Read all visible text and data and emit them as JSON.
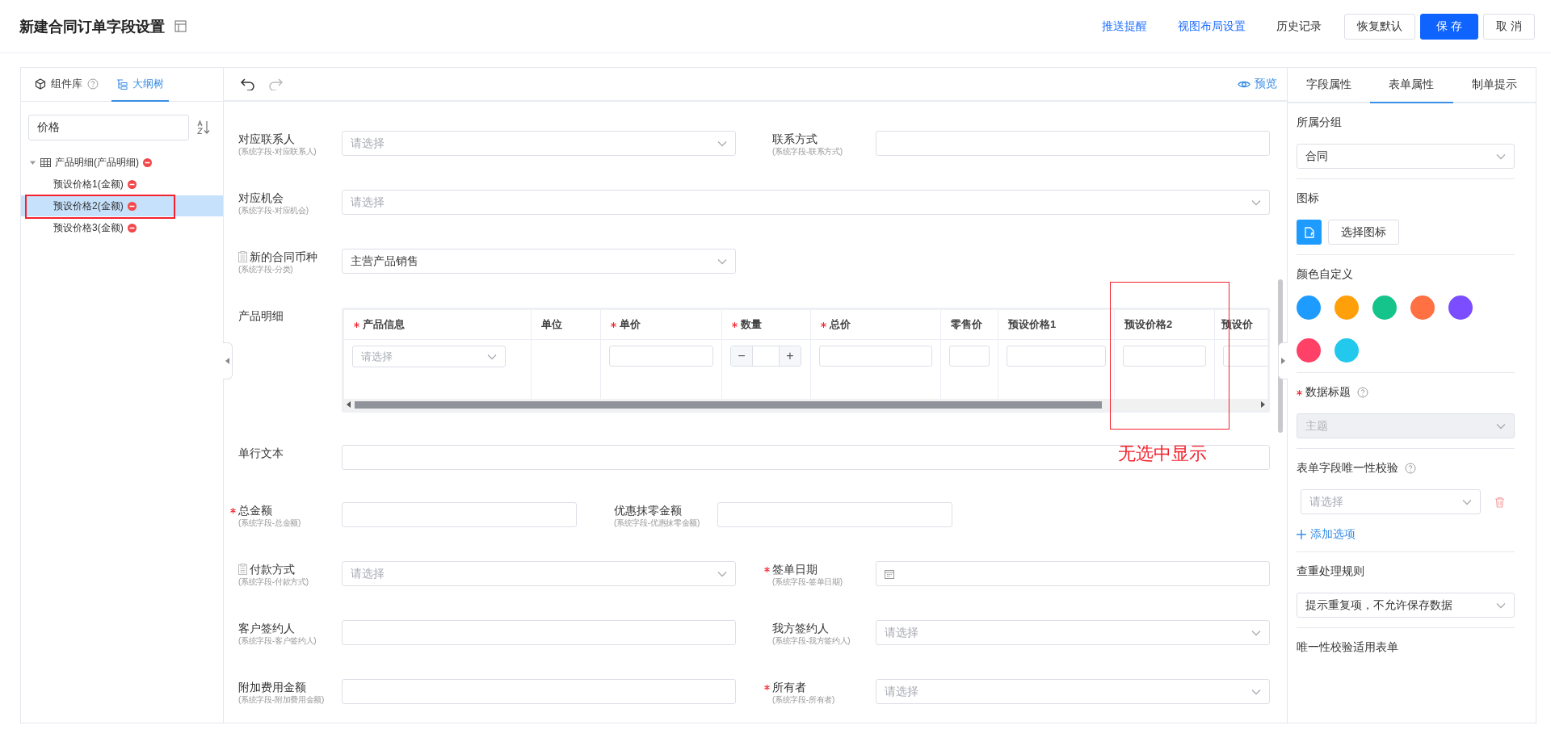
{
  "header": {
    "title": "新建合同订单字段设置",
    "links": [
      {
        "label": "推送提醒",
        "kind": "link"
      },
      {
        "label": "视图布局设置",
        "kind": "link"
      },
      {
        "label": "历史记录",
        "kind": "plain"
      }
    ],
    "buttons": [
      {
        "label": "恢复默认",
        "kind": "default"
      },
      {
        "label": "保 存",
        "kind": "primary"
      },
      {
        "label": "取 消",
        "kind": "default"
      }
    ]
  },
  "left_panel": {
    "tabs": [
      {
        "label": "组件库",
        "selected": false,
        "help": true
      },
      {
        "label": "大纲树",
        "selected": true,
        "help": false
      }
    ],
    "search": {
      "value": "价格"
    },
    "tree": [
      {
        "label": "产品明细(产品明细)",
        "expanded": true,
        "selected": false,
        "children": [
          {
            "label": "预设价格1(金额)",
            "selected": false
          },
          {
            "label": "预设价格2(金额)",
            "selected": true
          },
          {
            "label": "预设价格3(金额)",
            "selected": false
          }
        ]
      }
    ]
  },
  "canvas": {
    "preview": "预览",
    "rows": [
      {
        "fields": [
          {
            "label": "对应联系人",
            "hint": "(系统字段-对应联系人)",
            "required": false,
            "kind": "select",
            "placeholder": "请选择"
          },
          {
            "label": "联系方式",
            "hint": "(系统字段-联系方式)",
            "required": false,
            "kind": "input"
          }
        ]
      },
      {
        "fields": [
          {
            "label": "对应机会",
            "hint": "(系统字段-对应机会)",
            "required": false,
            "kind": "select",
            "placeholder": "请选择"
          }
        ]
      },
      {
        "fields": [
          {
            "label": "新的合同币种",
            "hint": "(系统字段-分类)",
            "required": false,
            "icon": true,
            "kind": "select",
            "value": "主营产品销售"
          }
        ]
      },
      {
        "fields": [
          {
            "label": "产品明细",
            "required": false,
            "kind": "table"
          }
        ]
      },
      {
        "fields": [
          {
            "label": "单行文本",
            "required": false,
            "kind": "input"
          }
        ]
      },
      {
        "fields": [
          {
            "label": "总金额",
            "hint": "(系统字段-总金额)",
            "required": true,
            "kind": "input"
          },
          {
            "label": "优惠抹零金额",
            "hint": "(系统字段-优惠抹零金额)",
            "required": false,
            "kind": "input"
          }
        ]
      },
      {
        "fields": [
          {
            "label": "付款方式",
            "hint": "(系统字段-付款方式)",
            "required": false,
            "icon": true,
            "kind": "select",
            "placeholder": "请选择"
          },
          {
            "label": "签单日期",
            "hint": "(系统字段-签单日期)",
            "required": true,
            "kind": "date"
          }
        ]
      },
      {
        "fields": [
          {
            "label": "客户签约人",
            "hint": "(系统字段-客户签约人)",
            "required": false,
            "kind": "input"
          },
          {
            "label": "我方签约人",
            "hint": "(系统字段-我方签约人)",
            "required": false,
            "kind": "select",
            "placeholder": "请选择"
          }
        ]
      },
      {
        "fields": [
          {
            "label": "附加费用金额",
            "hint": "(系统字段-附加费用金额)",
            "required": false,
            "kind": "input"
          },
          {
            "label": "所有者",
            "hint": "(系统字段-所有者)",
            "required": true,
            "kind": "select",
            "placeholder": "请选择"
          }
        ]
      }
    ],
    "table": {
      "columns": [
        {
          "label": "产品信息",
          "required": true,
          "cell": {
            "kind": "select",
            "placeholder": "请选择"
          }
        },
        {
          "label": "单位",
          "required": false,
          "cell": {
            "kind": "empty"
          }
        },
        {
          "label": "单价",
          "required": true,
          "cell": {
            "kind": "input"
          }
        },
        {
          "label": "数量",
          "required": true,
          "cell": {
            "kind": "stepper",
            "minus": "−",
            "plus": "+"
          }
        },
        {
          "label": "总价",
          "required": true,
          "cell": {
            "kind": "input"
          }
        },
        {
          "label": "零售价",
          "required": false,
          "cell": {
            "kind": "input"
          }
        },
        {
          "label": "预设价格1",
          "required": false,
          "cell": {
            "kind": "input"
          }
        },
        {
          "label": "预设价格2",
          "required": false,
          "cell": {
            "kind": "input"
          }
        },
        {
          "label": "预设价",
          "required": false,
          "cell": {
            "kind": "input"
          }
        }
      ]
    }
  },
  "annotation": {
    "text": "无选中显示"
  },
  "props_panel": {
    "tabs": [
      {
        "label": "字段属性",
        "selected": false
      },
      {
        "label": "表单属性",
        "selected": true
      },
      {
        "label": "制单提示",
        "selected": false
      }
    ],
    "sections": [
      {
        "kind": "select",
        "label": "所属分组",
        "required": false,
        "help": false,
        "value": "合同",
        "disabled": false
      },
      {
        "kind": "icon",
        "label": "图标",
        "button": "选择图标"
      },
      {
        "kind": "colors",
        "label": "颜色自定义",
        "colors": [
          {
            "color": "#1e9bff"
          },
          {
            "color": "#ffa00a"
          },
          {
            "color": "#14c48a"
          },
          {
            "color": "#ff7043"
          },
          {
            "color": "#7c4dff"
          },
          {
            "color": "#ff4067"
          },
          {
            "color": "#22c9ec"
          }
        ]
      },
      {
        "kind": "select",
        "label": "数据标题",
        "required": true,
        "help": true,
        "placeholder": "主题",
        "disabled": true
      },
      {
        "kind": "unique",
        "label": "表单字段唯一性校验",
        "help": true,
        "placeholder": "请选择",
        "add": "添加选项"
      },
      {
        "kind": "select",
        "label": "查重处理规则",
        "required": false,
        "help": false,
        "value": "提示重复项，不允许保存数据",
        "disabled": false
      },
      {
        "kind": "label",
        "label": "唯一性校验适用表单"
      }
    ]
  }
}
